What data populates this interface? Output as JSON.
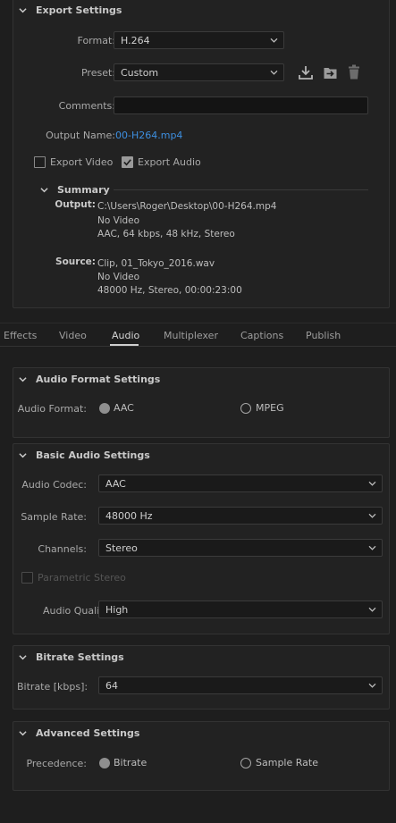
{
  "export_settings": {
    "title": "Export Settings",
    "format_label": "Format:",
    "format_value": "H.264",
    "preset_label": "Preset:",
    "preset_value": "Custom",
    "comments_label": "Comments:",
    "comments_value": "",
    "output_name_label": "Output Name:",
    "output_name_value": "00-H264.mp4",
    "export_video_label": "Export Video",
    "export_video_checked": false,
    "export_audio_label": "Export Audio",
    "export_audio_checked": true,
    "summary": {
      "title": "Summary",
      "output_key": "Output:",
      "output_lines": [
        "C:\\Users\\Roger\\Desktop\\00-H264.mp4",
        "No Video",
        "AAC, 64 kbps, 48 kHz, Stereo"
      ],
      "source_key": "Source:",
      "source_lines": [
        "Clip, 01_Tokyo_2016.wav",
        "No Video",
        "48000 Hz, Stereo, 00:00:23:00"
      ]
    }
  },
  "tabs": [
    {
      "label": "Effects"
    },
    {
      "label": "Video"
    },
    {
      "label": "Audio",
      "active": true
    },
    {
      "label": "Multiplexer"
    },
    {
      "label": "Captions"
    },
    {
      "label": "Publish"
    }
  ],
  "audio_format_settings": {
    "title": "Audio Format Settings",
    "format_label": "Audio Format:",
    "option_aac": "AAC",
    "option_mpeg": "MPEG",
    "selected": "AAC"
  },
  "basic_audio_settings": {
    "title": "Basic Audio Settings",
    "codec_label": "Audio Codec:",
    "codec_value": "AAC",
    "sample_rate_label": "Sample Rate:",
    "sample_rate_value": "48000 Hz",
    "channels_label": "Channels:",
    "channels_value": "Stereo",
    "parametric_stereo_label": "Parametric Stereo",
    "audio_quality_label": "Audio Quality:",
    "audio_quality_value": "High"
  },
  "bitrate_settings": {
    "title": "Bitrate Settings",
    "bitrate_label": "Bitrate [kbps]:",
    "bitrate_value": "64"
  },
  "advanced_settings": {
    "title": "Advanced Settings",
    "precedence_label": "Precedence:",
    "option_bitrate": "Bitrate",
    "option_sample_rate": "Sample Rate",
    "selected": "Bitrate"
  },
  "colors": {
    "background": "#1e1e1e",
    "panel": "#222222",
    "link": "#3d8fe0",
    "text": "#a9a9a9"
  }
}
